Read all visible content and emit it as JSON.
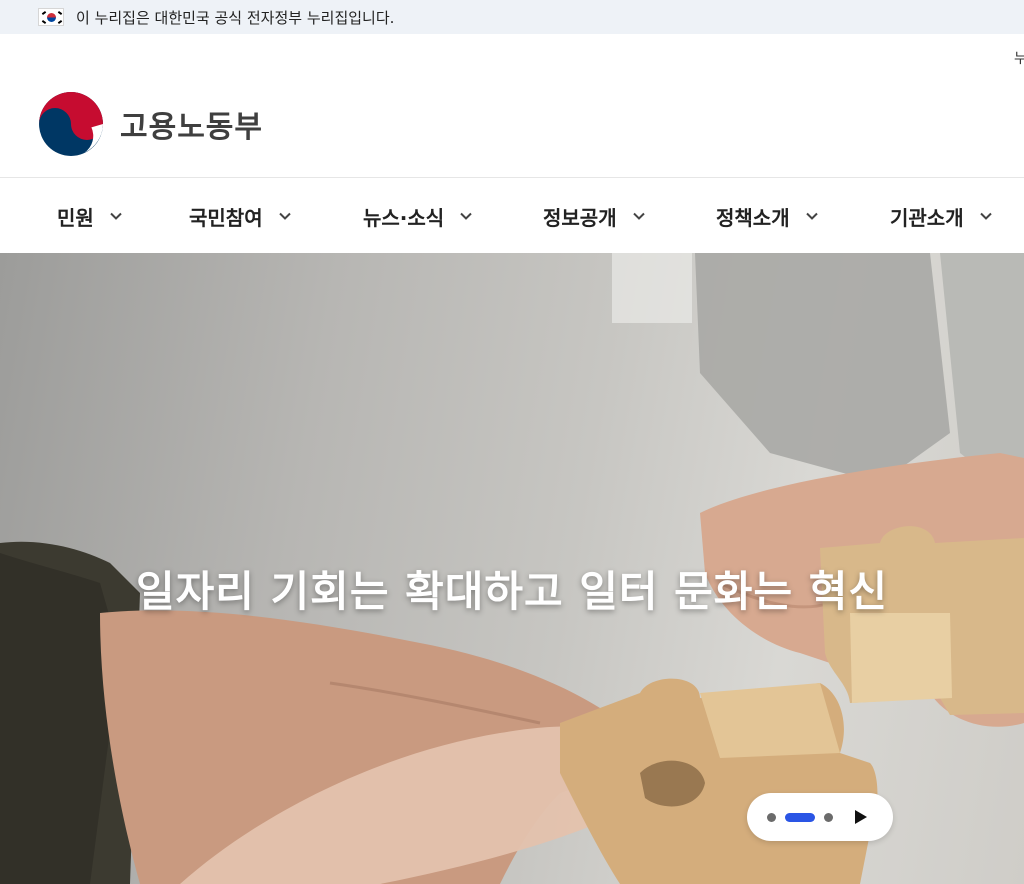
{
  "gov_banner": {
    "text": "이 누리집은 대한민국 공식 전자정부 누리집입니다.",
    "icon": "korea-flag-icon"
  },
  "header": {
    "util_cut_text": "누",
    "logo_text": "고용노동부",
    "emblem_icon": "taegeuk-emblem-icon"
  },
  "gnb": {
    "items": [
      {
        "label": "민원"
      },
      {
        "label": "국민참여"
      },
      {
        "label": "뉴스·소식"
      },
      {
        "label": "정보공개"
      },
      {
        "label": "정책소개"
      },
      {
        "label": "기관소개"
      }
    ],
    "chevron_icon": "chevron-down-icon"
  },
  "hero": {
    "title": "일자리 기회는 확대하고 일터 문화는 혁신",
    "slide_total": 3,
    "slide_active": 2,
    "accent_color": "#2a55e5",
    "play_icon": "play-icon"
  }
}
